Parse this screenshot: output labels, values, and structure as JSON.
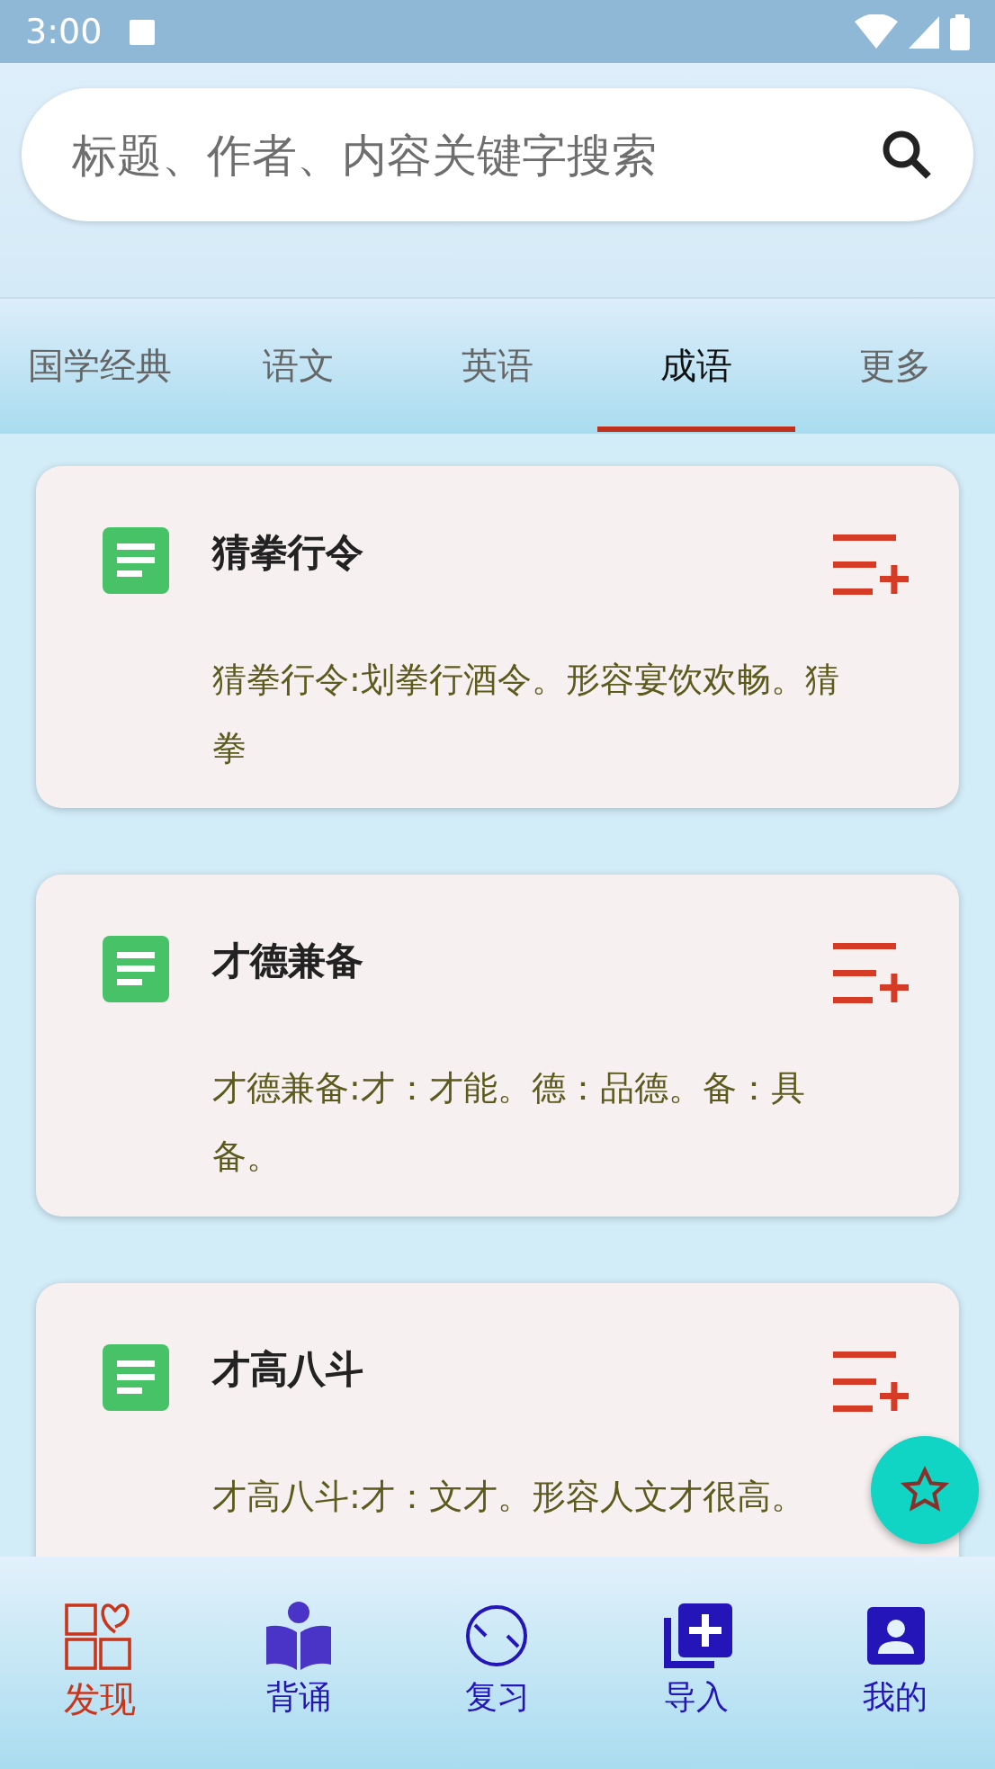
{
  "status_bar": {
    "time": "3:00"
  },
  "search": {
    "placeholder": "标题、作者、内容关键字搜索"
  },
  "tabs": [
    {
      "label": "国学经典",
      "selected": false
    },
    {
      "label": "语文",
      "selected": false
    },
    {
      "label": "英语",
      "selected": false
    },
    {
      "label": "成语",
      "selected": true
    },
    {
      "label": "更多",
      "selected": false
    }
  ],
  "cards": [
    {
      "title": "猜拳行令",
      "text": "猜拳行令:划拳行酒令。形容宴饮欢畅。猜拳"
    },
    {
      "title": "才德兼备",
      "text": "才德兼备:才：才能。德：品德。备：具备。"
    },
    {
      "title": "才高八斗",
      "text": "才高八斗:才：文才。形容人文才很高。"
    }
  ],
  "bottom_nav": [
    {
      "label": "发现",
      "selected": true
    },
    {
      "label": "背诵",
      "selected": false
    },
    {
      "label": "复习",
      "selected": false
    },
    {
      "label": "导入",
      "selected": false
    },
    {
      "label": "我的",
      "selected": false
    }
  ]
}
